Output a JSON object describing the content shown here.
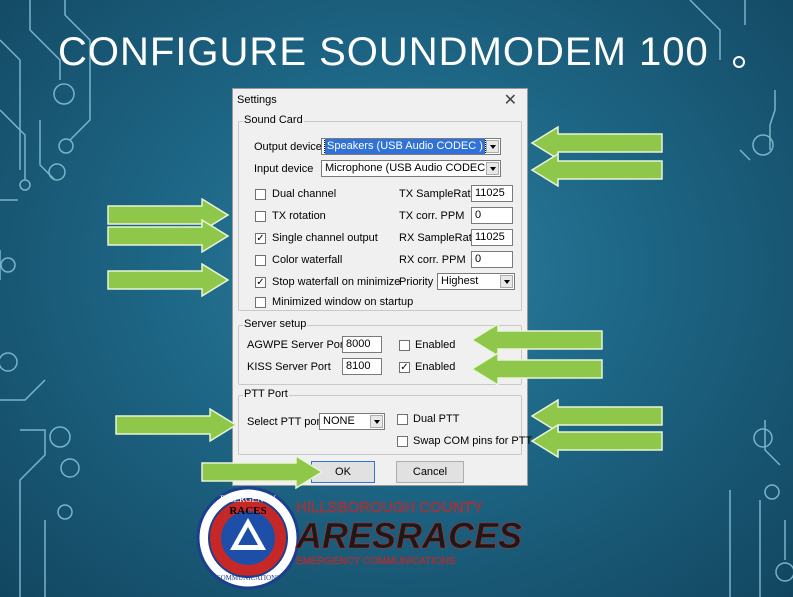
{
  "slide": {
    "title": "CONFIGURE SOUNDMODEM 100",
    "colors": {
      "background": "#1d6584",
      "arrow_fill": "#8fc74a",
      "arrow_stroke": "#e9f4d8",
      "title": "#ffffff"
    }
  },
  "dialog": {
    "title": "Settings",
    "close_glyph": "✕",
    "sound_card": {
      "legend": "Sound Card",
      "output_label": "Output device",
      "output_value": "Speakers (USB Audio CODEC )",
      "input_label": "Input device",
      "input_value": "Microphone (USB Audio CODEC )",
      "options": [
        {
          "label": "Dual channel",
          "checked": false
        },
        {
          "label": "TX rotation",
          "checked": false
        },
        {
          "label": "Single channel output",
          "checked": true
        },
        {
          "label": "Color waterfall",
          "checked": false
        },
        {
          "label": "Stop waterfall on minimize",
          "checked": true
        },
        {
          "label": "Minimized window on startup",
          "checked": false
        }
      ],
      "tx_samplerate_label": "TX SampleRate",
      "tx_samplerate_value": "11025",
      "tx_ppm_label": "TX corr. PPM",
      "tx_ppm_value": "0",
      "rx_samplerate_label": "RX SampleRate",
      "rx_samplerate_value": "11025",
      "rx_ppm_label": "RX corr. PPM",
      "rx_ppm_value": "0",
      "priority_label": "Priority",
      "priority_value": "Highest"
    },
    "server": {
      "legend": "Server setup",
      "agwpe_label": "AGWPE Server Port",
      "agwpe_port": "8000",
      "agwpe_enabled_label": "Enabled",
      "agwpe_enabled": false,
      "kiss_label": "KISS Server Port",
      "kiss_port": "8100",
      "kiss_enabled_label": "Enabled",
      "kiss_enabled": true
    },
    "ptt": {
      "legend": "PTT Port",
      "select_label": "Select PTT port",
      "select_value": "NONE",
      "dual_ptt_label": "Dual PTT",
      "dual_ptt": false,
      "swap_label": "Swap COM pins for PTT",
      "swap": false
    },
    "ok_label": "OK",
    "cancel_label": "Cancel"
  },
  "logo": {
    "seal_top": "EMERGENCY",
    "seal_center": "RACES",
    "seal_bottom": "COMMUNICATIONS",
    "county": "HILLSBOROUGH COUNTY",
    "brand_left": "ARES",
    "brand_right": "RACES",
    "tagline": "EMERGENCY COMMUNICATIONS"
  }
}
